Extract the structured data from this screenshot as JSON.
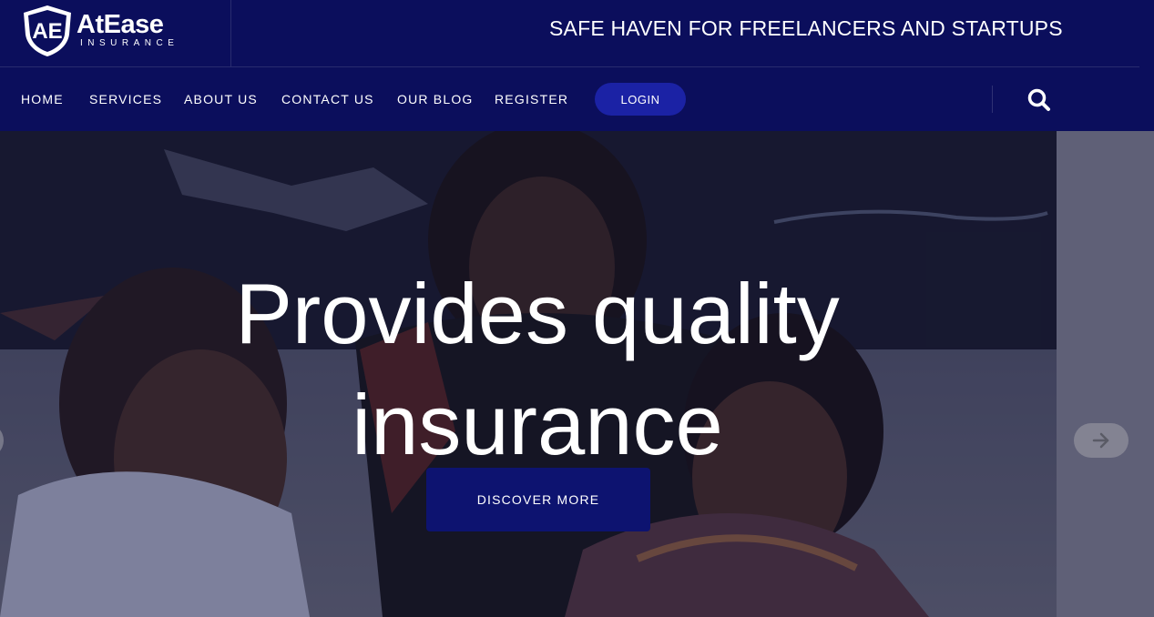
{
  "header": {
    "logo": {
      "name": "AtEase",
      "subtitle": "INSURANCE",
      "monogram": "AE"
    },
    "tagline": "SAFE HAVEN FOR FREELANCERS AND STARTUPS"
  },
  "nav": {
    "items": [
      {
        "label": "HOME"
      },
      {
        "label": "SERVICES"
      },
      {
        "label": "ABOUT US"
      },
      {
        "label": "CONTACT US"
      },
      {
        "label": "OUR BLOG"
      },
      {
        "label": "REGISTER"
      }
    ],
    "login_label": "LOGIN",
    "search_icon": "search-icon"
  },
  "hero": {
    "title_line1": "Provides quality",
    "title_line2": "insurance",
    "cta_label": "DISCOVER MORE",
    "next_icon": "arrow-right-icon",
    "prev_icon": "arrow-left-icon"
  },
  "colors": {
    "navy": "#0b0e5c",
    "login_button": "#1b22a5",
    "cta_button": "#0d1370",
    "text": "#ffffff"
  }
}
